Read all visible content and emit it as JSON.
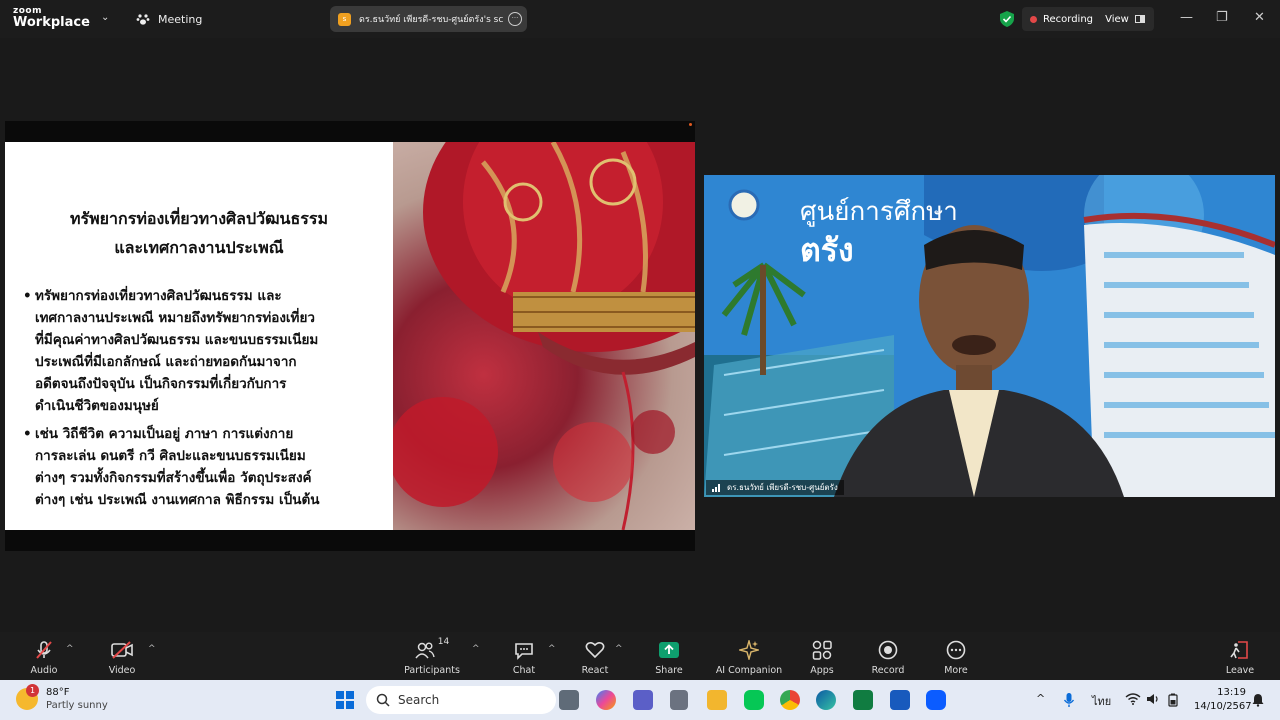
{
  "app": {
    "logo_line1": "zoom",
    "logo_line2": "Workplace",
    "meeting_label": "Meeting"
  },
  "share_pill": {
    "title": "ดร.ธนวัทย์ เพียรดี-รชบ-ศูนย์ตรัง's sc",
    "icon_letter": "s"
  },
  "status": {
    "recording_label": "Recording",
    "view_label": "View"
  },
  "slide": {
    "title_line1": "ทรัพยากรท่องเที่ยวทางศิลปวัฒนธรรม",
    "title_line2": "และเทศกาลงานประเพณี",
    "bullet1": [
      "ทรัพยากรท่องเที่ยวทางศิลปวัฒนธรรม และ",
      "เทศกาลงานประเพณี หมายถึงทรัพยากรท่องเที่ยว",
      "ที่มีคุณค่าทางศิลปวัฒนธรรม และขนบธรรมเนียม",
      "ประเพณีที่มีเอกลักษณ์ และถ่ายทอดกันมาจาก",
      "อดีตจนถึงปัจจุบัน เป็นกิจกรรมที่เกี่ยวกับการ",
      "ดำเนินชีวิตของมนุษย์"
    ],
    "bullet2": [
      "เช่น วิถีชีวิต ความเป็นอยู่ ภาษา การแต่งกาย",
      "การละเล่น ดนตรี กวี ศิลปะและขนบธรรมเนียม",
      "ต่างๆ รวมทั้งกิจกรรมที่สร้างขึ้นเพื่อ วัตถุประสงค์",
      "ต่างๆ เช่น ประเพณี งานเทศกาล พิธีกรรม เป็นต้น"
    ]
  },
  "video": {
    "bg_text_line1": "ศูนย์การศึกษา",
    "bg_text_line2": "ตรัง",
    "participant_name": "ดร.ธนวัทย์ เพียรดี-รชบ-ศูนย์ตรัง"
  },
  "toolbar": {
    "audio": "Audio",
    "video": "Video",
    "participants": "Participants",
    "participants_count": "14",
    "chat": "Chat",
    "react": "React",
    "share": "Share",
    "ai": "AI Companion",
    "apps": "Apps",
    "record": "Record",
    "more": "More",
    "leave": "Leave"
  },
  "taskbar": {
    "temp": "88°F",
    "weather": "Partly sunny",
    "badge": "1",
    "search_placeholder": "Search",
    "lang": "ไทย",
    "time": "13:19",
    "date": "14/10/2567"
  },
  "colors": {
    "accent_green": "#0e9f6e",
    "record_red": "#e34848",
    "brand_blue": "#0b5cff"
  }
}
